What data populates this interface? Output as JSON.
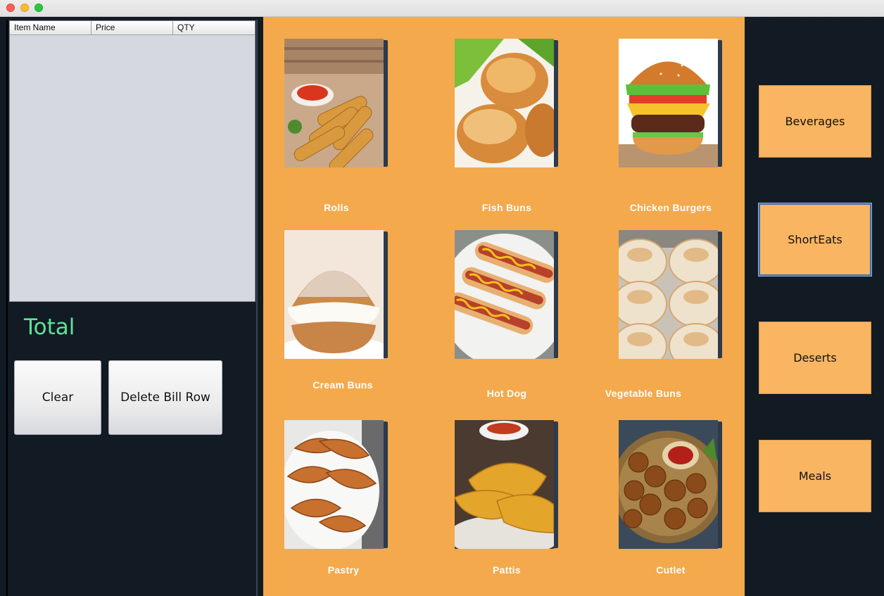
{
  "bill": {
    "columns": [
      "Item Name",
      "Price",
      "QTY"
    ],
    "rows": [],
    "total_label": "Total"
  },
  "actions": {
    "clear_label": "Clear",
    "delete_label": "Delete Bill Row"
  },
  "menu_items": [
    {
      "label": "Rolls",
      "icon": "spring-rolls-photo"
    },
    {
      "label": "Fish Buns",
      "icon": "fish-buns-photo"
    },
    {
      "label": "Chicken Burgers",
      "icon": "chicken-burger-photo"
    },
    {
      "label": "Cream Buns",
      "icon": "cream-bun-photo"
    },
    {
      "label": "Hot Dog",
      "icon": "hot-dog-photo"
    },
    {
      "label": "Vegetable Buns",
      "icon": "vegetable-buns-photo"
    },
    {
      "label": "Pastry",
      "icon": "croissant-pastry-photo"
    },
    {
      "label": "Pattis",
      "icon": "pattis-photo"
    },
    {
      "label": "Cutlet",
      "icon": "cutlet-photo"
    }
  ],
  "categories": [
    {
      "label": "Beverages",
      "active": false
    },
    {
      "label": "ShortEats",
      "active": true
    },
    {
      "label": "Deserts",
      "active": false
    },
    {
      "label": "Meals",
      "active": false
    }
  ],
  "colors": {
    "menu_bg": "#f4a94d",
    "category_bg": "#f9b562",
    "panel_bg": "#121a23",
    "total_text": "#5fe39a"
  }
}
